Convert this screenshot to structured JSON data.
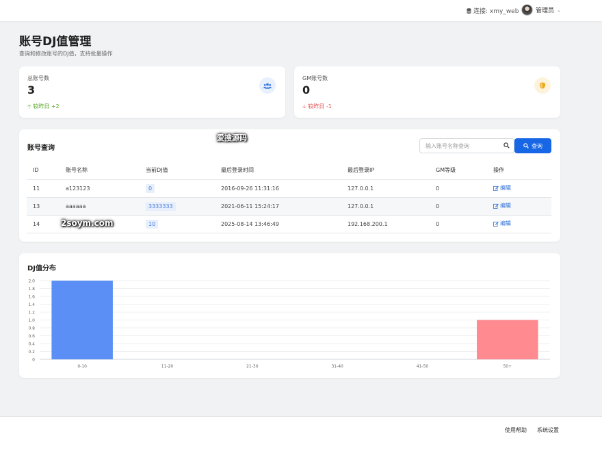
{
  "topbar": {
    "connection_text": "连接: xmy_web",
    "user_name": "管理员"
  },
  "page": {
    "title": "账号DJ值管理",
    "subtitle": "查询和修改账号的DJ值，支持批量操作"
  },
  "stats": [
    {
      "label": "总账号数",
      "value": "3",
      "change": "较昨日 +2",
      "trend": "up",
      "icon": "users-icon",
      "icon_color": "#3d7be3",
      "icon_bg": "#e8f0fd"
    },
    {
      "label": "GM账号数",
      "value": "0",
      "change": "较昨日 -1",
      "trend": "down",
      "icon": "shield-icon",
      "icon_color": "#e9a820",
      "icon_bg": "#fdf3dc"
    }
  ],
  "query": {
    "title": "账号查询",
    "search_placeholder": "输入账号名称查询",
    "search_value": "",
    "button_label": "查询",
    "columns": [
      "ID",
      "账号名称",
      "当前DJ值",
      "最后登录时间",
      "最后登录IP",
      "GM等级",
      "操作"
    ],
    "rows": [
      {
        "id": "11",
        "name": "a123123",
        "dj": "0",
        "last_login": "2016-09-26 11:31:16",
        "ip": "127.0.0.1",
        "gm": "0",
        "action": "编辑"
      },
      {
        "id": "13",
        "name": "aaaaaa",
        "dj": "3333333",
        "last_login": "2021-06-11 15:24:17",
        "ip": "127.0.0.1",
        "gm": "0",
        "action": "编辑"
      },
      {
        "id": "14",
        "name": "",
        "dj": "10",
        "last_login": "2025-08-14 13:46:49",
        "ip": "192.168.200.1",
        "gm": "0",
        "action": "编辑"
      }
    ]
  },
  "watermarks": [
    "爱搜源码",
    "2soym.com"
  ],
  "chart": {
    "title": "DJ值分布"
  },
  "chart_data": {
    "type": "bar",
    "categories": [
      "0-10",
      "11-20",
      "21-30",
      "31-40",
      "41-50",
      "50+"
    ],
    "values": [
      2,
      0,
      0,
      0,
      0,
      1
    ],
    "colors": [
      "#5b8ff5",
      "#ff8a8f"
    ],
    "ylim": [
      0,
      2.0
    ],
    "yticks": [
      "0",
      "0.2",
      "0.4",
      "0.6",
      "0.8",
      "1.0",
      "1.2",
      "1.4",
      "1.6",
      "1.8",
      "2.0"
    ],
    "grid": true,
    "legend": "none"
  },
  "footer": {
    "links": [
      "使用帮助",
      "系统设置"
    ]
  }
}
